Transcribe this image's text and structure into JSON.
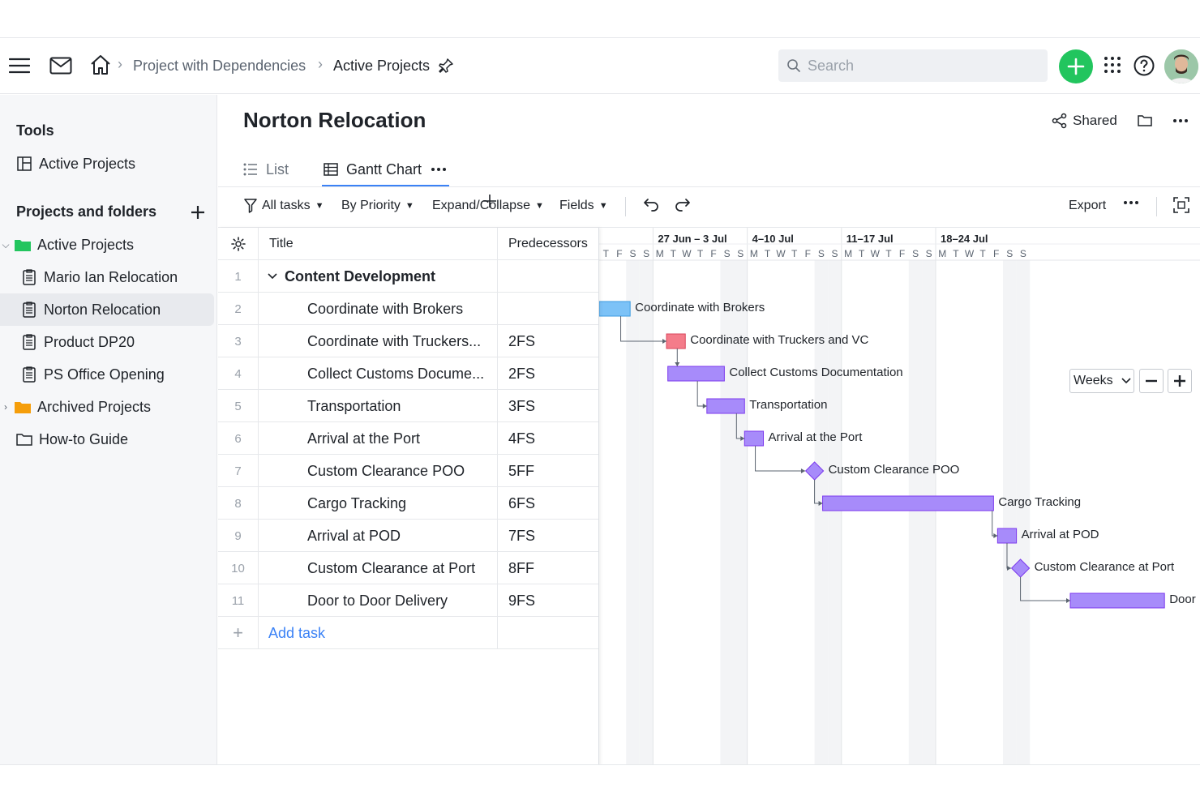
{
  "topbar": {
    "breadcrumb": [
      "Project with Dependencies",
      "Active Projects"
    ],
    "search_placeholder": "Search"
  },
  "sidebar": {
    "tools_heading": "Tools",
    "tools_items": [
      {
        "label": "Active Projects"
      }
    ],
    "projects_heading": "Projects and folders",
    "items": [
      {
        "label": "Active Projects"
      },
      {
        "label": "Mario Ian Relocation"
      },
      {
        "label": "Norton Relocation"
      },
      {
        "label": "Product DP20"
      },
      {
        "label": "PS Office Opening"
      },
      {
        "label": "Archived Projects"
      },
      {
        "label": "How-to Guide"
      }
    ]
  },
  "main": {
    "title": "Norton Relocation",
    "shared_label": "Shared",
    "tabs": [
      {
        "label": "List"
      },
      {
        "label": "Gantt Chart"
      }
    ],
    "toolbar": {
      "all_tasks": "All tasks",
      "by_priority": "By Priority",
      "expand_collapse": "Expand/Collapse",
      "fields": "Fields",
      "export": "Export"
    }
  },
  "grid": {
    "headers": {
      "title": "Title",
      "predecessors": "Predecessors"
    },
    "rows": [
      {
        "num": "1",
        "title": "Content Development",
        "pred": ""
      },
      {
        "num": "2",
        "title": "Coordinate with Brokers",
        "pred": ""
      },
      {
        "num": "3",
        "title": "Coordinate with Truckers...",
        "pred": "2FS"
      },
      {
        "num": "4",
        "title": "Collect Customs Docume...",
        "pred": "2FS"
      },
      {
        "num": "5",
        "title": "Transportation",
        "pred": "3FS"
      },
      {
        "num": "6",
        "title": "Arrival at the Port",
        "pred": "4FS"
      },
      {
        "num": "7",
        "title": "Custom Clearance POO",
        "pred": "5FF"
      },
      {
        "num": "8",
        "title": "Cargo Tracking",
        "pred": "6FS"
      },
      {
        "num": "9",
        "title": "Arrival at POD",
        "pred": "7FS"
      },
      {
        "num": "10",
        "title": "Custom Clearance at Port",
        "pred": "8FF"
      },
      {
        "num": "11",
        "title": "Door to Door Delivery",
        "pred": "9FS"
      }
    ],
    "add_task": "Add task"
  },
  "gantt": {
    "weeks": [
      "27 Jun – 3 Jul",
      "4–10 Jul",
      "11–17 Jul",
      "18–24 Jul"
    ],
    "days": [
      "T",
      "F",
      "S",
      "S",
      "M",
      "T",
      "W",
      "T",
      "F",
      "S",
      "S",
      "M",
      "T",
      "W",
      "T",
      "F",
      "S",
      "S",
      "M",
      "T",
      "W",
      "T",
      "F",
      "S",
      "S",
      "M",
      "T",
      "W",
      "T",
      "F",
      "S",
      "S"
    ],
    "scale": "Weeks",
    "bar_labels": [
      "Coordinate with Brokers",
      "Coordinate with Truckers and VC",
      "Collect Customs Documentation",
      "Transportation",
      "Arrival at the Port",
      "Custom Clearance POO",
      "Cargo Tracking",
      "Arrival at POD",
      "Custom Clearance at Port",
      "Door"
    ],
    "colors": {
      "purple": "#a78bfa",
      "blue": "#7cc2f7",
      "red": "#f47c8a",
      "accent": "#22c55e"
    }
  }
}
